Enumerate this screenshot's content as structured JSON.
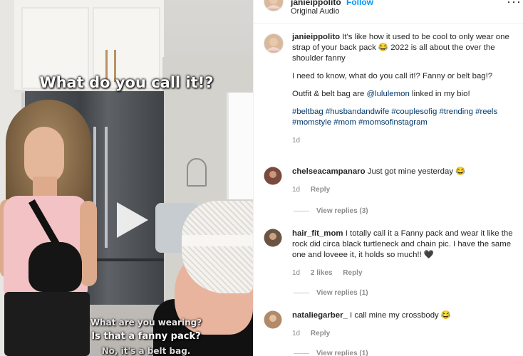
{
  "video": {
    "overlay_title": "What do you call it!?",
    "subtitle_1": "What are you wearing?",
    "subtitle_2": "Is that a fanny pack?",
    "subtitle_3": "No, it's a belt bag."
  },
  "header": {
    "username": "janieippolito",
    "follow": "Follow",
    "audio": "Original Audio",
    "more_icon": "more-icon"
  },
  "caption": {
    "username": "janieippolito",
    "text_1": "It's like how it used to be cool to only wear one strap of your back pack 😂 2022 is all about the over the shoulder fanny",
    "text_2": "I need to know, what do you call it!? Fanny or belt bag!?",
    "text_3_prefix": "Outfit & belt bag are ",
    "mention": "@lululemon",
    "text_3_suffix": " linked in my bio!",
    "hashtags_1": "#beltbag #husbandandwife #couplesofig #trending #reels",
    "hashtags_2": "#momstyle #mom #momsofinstagram",
    "time": "1d"
  },
  "comments": [
    {
      "username": "chelseacampanaro",
      "text": "Just got mine yesterday 😂",
      "time": "1d",
      "reply": "Reply",
      "replies": "View replies (3)",
      "avatar_color": "#7a4a3c"
    },
    {
      "username": "hair_fit_mom",
      "text": "I totally call it a Fanny pack and wear it like the rock did circa black turtleneck and chain pic. I have the same one and loveee it, it holds so much!! 🖤",
      "time": "1d",
      "likes": "2 likes",
      "reply": "Reply",
      "replies": "View replies (1)",
      "avatar_color": "#6b5442"
    },
    {
      "username": "nataliegarber_",
      "text": "I call mine my crossbody 😂",
      "time": "1d",
      "reply": "Reply",
      "replies": "View replies (1)",
      "avatar_color": "#b08a6a"
    }
  ]
}
